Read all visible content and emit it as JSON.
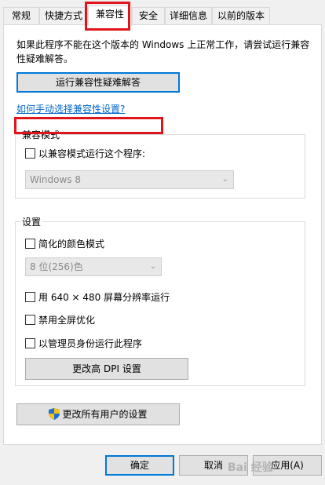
{
  "tabs": [
    {
      "label": "常规"
    },
    {
      "label": "快捷方式"
    },
    {
      "label": "兼容性"
    },
    {
      "label": "安全"
    },
    {
      "label": "详细信息"
    },
    {
      "label": "以前的版本"
    }
  ],
  "intro": "如果此程序不能在这个版本的 Windows 上正常工作，请尝试运行兼容性疑难解答。",
  "troubleshoot_button": "运行兼容性疑难解答",
  "manual_link": "如何手动选择兼容性设置?",
  "compat_mode": {
    "title": "兼容模式",
    "checkbox": "以兼容模式运行这个程序:",
    "select_value": "Windows 8"
  },
  "settings": {
    "title": "设置",
    "reduced_color": "简化的颜色模式",
    "color_value": "8 位(256)色",
    "res_640": "用 640 × 480 屏幕分辨率运行",
    "disable_fullscreen": "禁用全屏优化",
    "run_as_admin": "以管理员身份运行此程序",
    "dpi_button": "更改高 DPI 设置"
  },
  "all_users_button": "更改所有用户的设置",
  "footer": {
    "ok": "确定",
    "cancel": "取消",
    "apply": "应用(A)"
  },
  "watermark": "Bai 经验",
  "colors": {
    "accent": "#0078d7",
    "annotation": "#e0141b",
    "link": "#0066cc"
  }
}
